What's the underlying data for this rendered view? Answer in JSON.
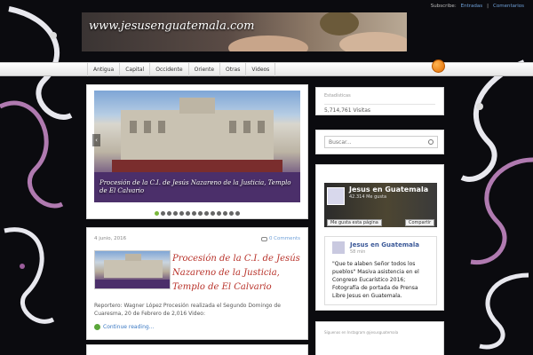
{
  "subscribe": {
    "label": "Subscribe:",
    "entries": "Entradas",
    "separator": "|",
    "comments": "Comentarios"
  },
  "header": {
    "title": "www.jesusenguatemala.com"
  },
  "nav": {
    "items": [
      "Antigua",
      "Capital",
      "Occidente",
      "Oriente",
      "Otras",
      "Videos"
    ]
  },
  "colors": {
    "accent": "#b8322a",
    "link": "#3a78c2",
    "nav_bg": "#eeeeee",
    "page_bg": "#0b0b0f"
  },
  "icons": {
    "rss": "rss-icon",
    "search": "search-icon",
    "comment": "comment-icon",
    "continue": "arrow-circle-icon"
  },
  "slider": {
    "caption": "Procesión de la C.I. de Jesús Nazareno de la Justicia, Templo de El Calvario",
    "prev_symbol": "‹",
    "dot_count": 14,
    "active_dot": 0
  },
  "post": {
    "date": "4 junio, 2016",
    "comments": "0 Comments",
    "title": "Procesión de la C.I. de Jesús Nazareno de la Justicia, Templo de El Calvario",
    "excerpt": "Reportero: Wagner López Procesión realizada el Segundo Domingo de Cuaresma, 20 de Febrero de 2,016 Video:",
    "continue": "Continue reading..."
  },
  "stats": {
    "title": "Estadísticas",
    "value": "5,714,761 Visitas"
  },
  "search": {
    "placeholder": "Buscar..."
  },
  "facebook": {
    "page_name": "Jesus en Guatemala",
    "likes": "42.314 Me gusta",
    "like_button": "Me gusta esta página",
    "share_button": "Compartir",
    "post_name": "Jesus en Guatemala",
    "post_time": "58 min",
    "post_text": "\"Que te alaben Señor todos los pueblos\" Masiva asistencia en el Congreso Eucarístico 2016; Fotografía de portada de Prensa Libre Jesus en Guatemala."
  },
  "instagram": {
    "title": "Síguenos en Instagram @jesusguatemala"
  }
}
